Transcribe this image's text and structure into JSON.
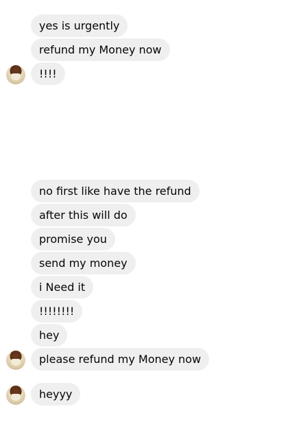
{
  "messages": [
    {
      "text": "yes is urgently"
    },
    {
      "text": "refund my Money now"
    },
    {
      "text": "!!!!"
    },
    {
      "text": "no first like have the refund"
    },
    {
      "text": "after this will do"
    },
    {
      "text": "promise you"
    },
    {
      "text": "send my money"
    },
    {
      "text": "i Need it"
    },
    {
      "text": "!!!!!!!!"
    },
    {
      "text": "hey"
    },
    {
      "text": "please refund my Money now"
    },
    {
      "text": "heyyy"
    }
  ],
  "icons": {
    "avatar": "sender-avatar"
  }
}
